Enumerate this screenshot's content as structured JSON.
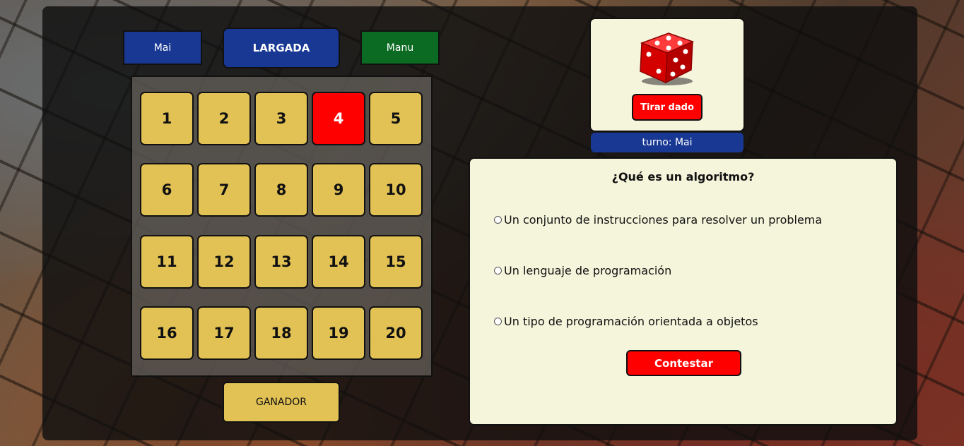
{
  "players": {
    "player1": "Mai",
    "start": "LARGADA",
    "player2": "Manu"
  },
  "board": {
    "cells": [
      "1",
      "2",
      "3",
      "4",
      "5",
      "6",
      "7",
      "8",
      "9",
      "10",
      "11",
      "12",
      "13",
      "14",
      "15",
      "16",
      "17",
      "18",
      "19",
      "20"
    ],
    "active_cell": "4"
  },
  "winner_label": "GANADOR",
  "dice": {
    "icon": "red-dice-icon",
    "roll_label": "Tirar dado"
  },
  "turn_label": "turno: Mai",
  "question": {
    "title": "¿Qué es un algoritmo?",
    "options": [
      "Un conjunto de instrucciones para resolver un problema",
      "Un lenguaje de programación",
      "Un tipo de programación orientada a objetos"
    ],
    "submit_label": "Contestar"
  },
  "colors": {
    "blue": "#183894",
    "green": "#0b6b22",
    "red": "#ff0000",
    "yellow": "#e2c255",
    "cream": "#f5f5dc"
  }
}
